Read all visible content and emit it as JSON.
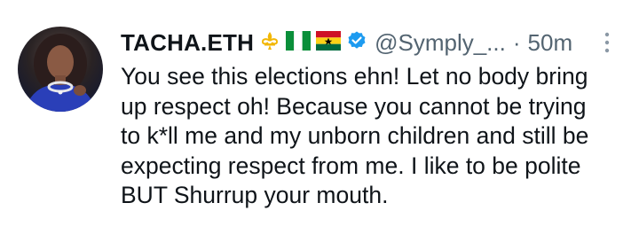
{
  "tweet": {
    "display_name": "TACHA.ETH",
    "handle": "@Symply_...",
    "separator": "·",
    "time": "50m",
    "lines": [
      "You see this elections ehn! Let no body bring",
      "up respect oh! Because you cannot be trying",
      "to k*ll me and my unborn children and still be",
      "expecting respect from me. I like to be polite",
      "BUT Shurrup your mouth."
    ],
    "emojis": [
      "fleur-de-lis-icon",
      "nigeria-flag-icon",
      "ghana-flag-icon"
    ],
    "verified_badge_color": "#1d9bf0",
    "emoji_color": "#f2b705"
  }
}
